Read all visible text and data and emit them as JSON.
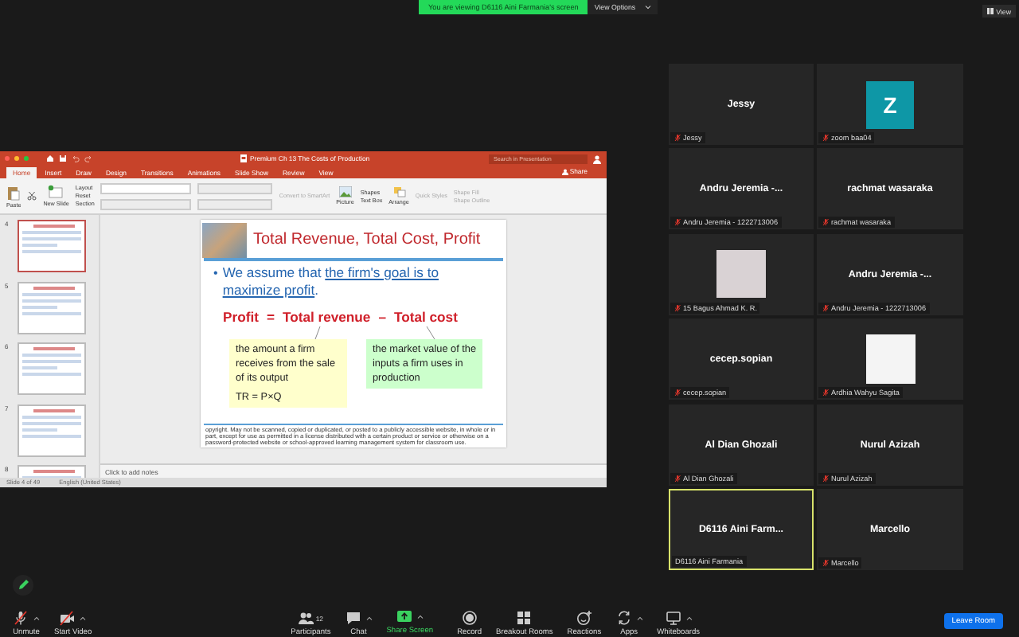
{
  "banner": {
    "text": "You are viewing D6116 Aini Farmania's screen",
    "options": "View Options"
  },
  "view_button": "View",
  "presentation": {
    "title": "Premium Ch 13 The Costs of Production",
    "search_placeholder": "Search in Presentation",
    "share": "Share",
    "tabs": [
      {
        "label": "Home",
        "selected": true
      },
      {
        "label": "Insert",
        "selected": false
      },
      {
        "label": "Draw",
        "selected": false
      },
      {
        "label": "Design",
        "selected": false
      },
      {
        "label": "Transitions",
        "selected": false
      },
      {
        "label": "Animations",
        "selected": false
      },
      {
        "label": "Slide Show",
        "selected": false
      },
      {
        "label": "Review",
        "selected": false
      },
      {
        "label": "View",
        "selected": false
      }
    ],
    "ribbon": {
      "paste": "Paste",
      "new_slide": "New Slide",
      "layout": "Layout",
      "reset": "Reset",
      "section": "Section",
      "smartart": "Convert to SmartArt",
      "picture": "Picture",
      "text_box": "Text Box",
      "shapes": "Shapes",
      "arrange": "Arrange",
      "quick_styles": "Quick Styles",
      "shape_fill": "Shape Fill",
      "shape_outline": "Shape Outline"
    },
    "thumbnails": [
      {
        "number": "4",
        "selected": true
      },
      {
        "number": "5",
        "selected": false
      },
      {
        "number": "6",
        "selected": false
      },
      {
        "number": "7",
        "selected": false
      },
      {
        "number": "8",
        "selected": false
      }
    ],
    "slide": {
      "title": "Total Revenue, Total Cost, Profit",
      "bullet": "•",
      "bullet_lead": "We assume that",
      "bullet_link": "the firm's goal is to maximize profit",
      "bullet_end": ".",
      "equation": [
        "Profit",
        "=",
        "Total revenue",
        "–",
        "Total cost"
      ],
      "boxes": [
        {
          "text": "the amount a firm receives from the sale of its output",
          "formula": "TR = P×Q",
          "color": "#ffffcc"
        },
        {
          "text": "the market value of the inputs a firm uses in production",
          "color": "#ccffcc"
        }
      ],
      "copyright": "opyright. May not be scanned, copied or duplicated, or posted to a publicly accessible website, in whole or in part, except for use as permitted in a license distributed with a certain product or service or otherwise on a password-protected website or school-approved learning management system for classroom use."
    },
    "notes_placeholder": "Click to add notes",
    "status": [
      "Slide 4 of 49",
      "English (United States)"
    ]
  },
  "participants": [
    {
      "kind": "name",
      "display": "Jessy",
      "label": "Jessy",
      "muted": true,
      "active": false
    },
    {
      "kind": "avatar",
      "display": "Z",
      "label": "zoom baa04",
      "muted": true,
      "active": false
    },
    {
      "kind": "name",
      "display": "Andru Jeremia -...",
      "label": "Andru Jeremia - 1222713006",
      "muted": true,
      "active": false
    },
    {
      "kind": "name",
      "display": "rachmat wasaraka",
      "label": "rachmat wasaraka",
      "muted": true,
      "active": false
    },
    {
      "kind": "photo",
      "label": "15 Bagus Ahmad K. R.",
      "muted": true,
      "active": false
    },
    {
      "kind": "name",
      "display": "Andru Jeremia -...",
      "label": "Andru Jeremia - 1222713006",
      "muted": true,
      "active": false
    },
    {
      "kind": "name",
      "display": "cecep.sopian",
      "label": "cecep.sopian",
      "muted": true,
      "active": false
    },
    {
      "kind": "photo",
      "label": "Ardhia Wahyu Sagita",
      "muted": true,
      "active": false
    },
    {
      "kind": "name",
      "display": "Al Dian Ghozali",
      "label": "Al Dian Ghozali",
      "muted": true,
      "active": false
    },
    {
      "kind": "name",
      "display": "Nurul Azizah",
      "label": "Nurul Azizah",
      "muted": true,
      "active": false
    },
    {
      "kind": "name",
      "display": "D6116  Aini  Farm...",
      "label": "D6116 Aini Farmania",
      "muted": false,
      "active": true
    },
    {
      "kind": "name",
      "display": "Marcello",
      "label": "Marcello",
      "muted": true,
      "active": false
    }
  ],
  "toolbar": [
    {
      "kind": "mic",
      "label": "Unmute",
      "caret": true
    },
    {
      "kind": "video",
      "label": "Start Video",
      "caret": true
    },
    {
      "kind": "participants",
      "label": "Participants",
      "count": "12",
      "caret": false
    },
    {
      "kind": "chat",
      "label": "Chat",
      "caret": true
    },
    {
      "kind": "share",
      "label": "Share Screen",
      "caret": true
    },
    {
      "kind": "record",
      "label": "Record",
      "caret": false
    },
    {
      "kind": "breakout",
      "label": "Breakout Rooms",
      "caret": false
    },
    {
      "kind": "reactions",
      "label": "Reactions",
      "caret": false
    },
    {
      "kind": "apps",
      "label": "Apps",
      "caret": true
    },
    {
      "kind": "whiteboards",
      "label": "Whiteboards",
      "caret": true
    }
  ],
  "leave_button": "Leave Room"
}
